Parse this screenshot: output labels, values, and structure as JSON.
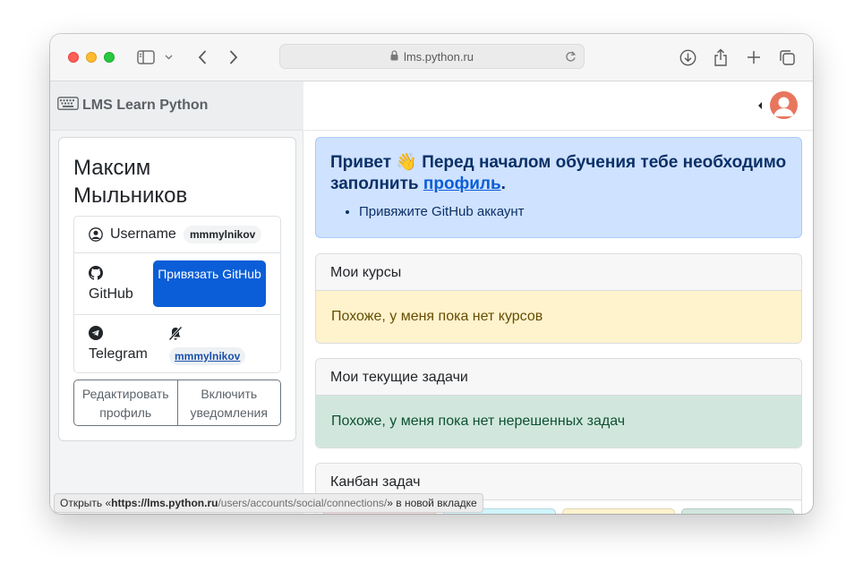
{
  "browser": {
    "url": "lms.python.ru",
    "icons": [
      "sidebar-icon",
      "chevron-down-icon",
      "back-icon",
      "forward-icon",
      "lock-icon",
      "reload-icon",
      "download-icon",
      "share-icon",
      "new-tab-icon",
      "tabs-overview-icon"
    ]
  },
  "app": {
    "brand": "LMS Learn Python",
    "brand_icon": "keyboard-icon"
  },
  "profile": {
    "name": "Максим Мыльников",
    "username_label": "Username",
    "username_value": "mmmylnikov",
    "github_label": "GitHub",
    "github_button": "Привязать GitHub",
    "telegram_label": "Telegram",
    "telegram_value": "mmmylnikov",
    "edit_button": "Редактировать профиль",
    "notify_button": "Включить уведомления"
  },
  "alert": {
    "title_before": "Привет 👋 Перед началом обучения тебе необходимо заполнить ",
    "title_link": "профиль",
    "title_after": ".",
    "items": [
      "Привяжите GitHub аккаунт"
    ]
  },
  "courses": {
    "header": "Мои курсы",
    "empty": "Похоже, у меня пока нет курсов"
  },
  "tasks": {
    "header": "Мои текущие задачи",
    "empty": "Похоже, у меня пока нет нерешенных задач"
  },
  "kanban": {
    "header": "Канбан задач",
    "columns": [
      "#f8d7da",
      "#cff4fc",
      "#fff3cd",
      "#d1e7dd"
    ]
  },
  "status": {
    "prefix": "Открыть «",
    "host": "https://lms.python.ru",
    "path": "/users/accounts/social/connections/",
    "suffix": "» в новой вкладке"
  },
  "colors": {
    "primary": "#0b5ed7",
    "alert_bg": "#cfe2ff",
    "warning_bg": "#fff3cd",
    "success_bg": "#d1e7dd"
  }
}
